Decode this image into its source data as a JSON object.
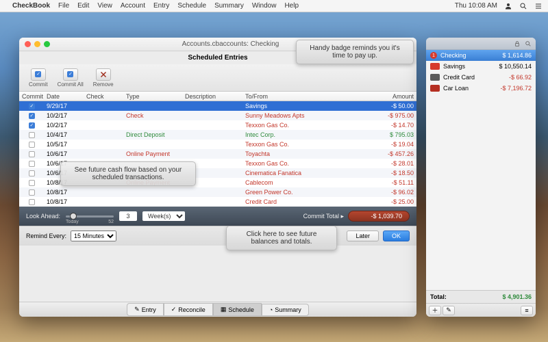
{
  "menubar": {
    "app": "CheckBook",
    "items": [
      "File",
      "Edit",
      "View",
      "Account",
      "Entry",
      "Schedule",
      "Summary",
      "Window",
      "Help"
    ],
    "clock": "Thu 10:08 AM"
  },
  "window": {
    "title": "Accounts.cbaccounts: Checking",
    "subtitle": "Scheduled Entries"
  },
  "toolbar": {
    "commit": "Commit",
    "commit_all": "Commit All",
    "remove": "Remove"
  },
  "columns": {
    "commit": "Commit",
    "date": "Date",
    "check": "Check",
    "type": "Type",
    "description": "Description",
    "tofrom": "To/From",
    "amount": "Amount"
  },
  "rows": [
    {
      "commit": true,
      "date": "9/29/17",
      "check": "",
      "type": "",
      "desc": "",
      "tofrom": "Savings",
      "amount": "-$ 50.00",
      "selected": true,
      "tocolor": "",
      "amtcolor": ""
    },
    {
      "commit": true,
      "date": "10/2/17",
      "check": "",
      "type": "Check",
      "desc": "",
      "tofrom": "Sunny Meadows Apts",
      "amount": "-$ 975.00",
      "selected": false,
      "tocolor": "red",
      "amtcolor": "red"
    },
    {
      "commit": true,
      "date": "10/2/17",
      "check": "",
      "type": "",
      "desc": "",
      "tofrom": "Texxon Gas Co.",
      "amount": "-$ 14.70",
      "selected": false,
      "tocolor": "red",
      "amtcolor": "red"
    },
    {
      "commit": false,
      "date": "10/4/17",
      "check": "",
      "type": "Direct Deposit",
      "desc": "",
      "tofrom": "Intec Corp.",
      "amount": "$ 795.03",
      "selected": false,
      "tocolor": "green",
      "amtcolor": "green"
    },
    {
      "commit": false,
      "date": "10/5/17",
      "check": "",
      "type": "",
      "desc": "",
      "tofrom": "Texxon Gas Co.",
      "amount": "-$ 19.04",
      "selected": false,
      "tocolor": "red",
      "amtcolor": "red"
    },
    {
      "commit": false,
      "date": "10/6/17",
      "check": "",
      "type": "Online Payment",
      "desc": "",
      "tofrom": "Toyachta",
      "amount": "-$ 457.26",
      "selected": false,
      "tocolor": "red",
      "amtcolor": "red"
    },
    {
      "commit": false,
      "date": "10/6/17",
      "check": "",
      "type": "",
      "desc": "",
      "tofrom": "Texxon Gas Co.",
      "amount": "-$ 28.01",
      "selected": false,
      "tocolor": "red",
      "amtcolor": "red"
    },
    {
      "commit": false,
      "date": "10/6/17",
      "check": "",
      "type": "",
      "desc": "",
      "tofrom": "Cinematica Fanatica",
      "amount": "-$ 18.50",
      "selected": false,
      "tocolor": "red",
      "amtcolor": "red"
    },
    {
      "commit": false,
      "date": "10/8/17",
      "check": "",
      "type": "Online Payment",
      "desc": "",
      "tofrom": "Cablecom",
      "amount": "-$ 51.11",
      "selected": false,
      "tocolor": "red",
      "amtcolor": "red"
    },
    {
      "commit": false,
      "date": "10/8/17",
      "check": "",
      "type": "",
      "desc": "",
      "tofrom": "Green Power Co.",
      "amount": "-$ 96.02",
      "selected": false,
      "tocolor": "red",
      "amtcolor": "red"
    },
    {
      "commit": false,
      "date": "10/8/17",
      "check": "",
      "type": "",
      "desc": "",
      "tofrom": "Credit Card",
      "amount": "-$ 25.00",
      "selected": false,
      "tocolor": "red",
      "amtcolor": "red"
    }
  ],
  "lookahead": {
    "label": "Look Ahead:",
    "today": "Today",
    "max": "52",
    "value": "3",
    "unit": "Week(s)",
    "commit_total_label": "Commit Total ▸",
    "commit_total": "-$ 1,039.70"
  },
  "remind": {
    "label": "Remind Every:",
    "value": "15 Minutes",
    "later": "Later",
    "ok": "OK"
  },
  "bottom_tabs": {
    "entry": "Entry",
    "reconcile": "Reconcile",
    "schedule": "Schedule",
    "summary": "Summary"
  },
  "accounts": {
    "header_icons": true,
    "list": [
      {
        "name": "Checking",
        "amount": "$ 1,614.86",
        "neg": false,
        "selected": true,
        "badge": "1"
      },
      {
        "name": "Savings",
        "amount": "$ 10,550.14",
        "neg": false,
        "selected": false,
        "color": "#d73a2d"
      },
      {
        "name": "Credit Card",
        "amount": "-$ 66.92",
        "neg": true,
        "selected": false,
        "color": "#5a5a5a"
      },
      {
        "name": "Car Loan",
        "amount": "-$ 7,196.72",
        "neg": true,
        "selected": false,
        "color": "#b52f22"
      }
    ],
    "total_label": "Total:",
    "total_amount": "$ 4,901.36"
  },
  "callouts": {
    "c1": "Handy badge reminds you it's time to pay up.",
    "c2": "See future cash flow based on your scheduled transactions.",
    "c3": "Click here to see future balances and totals."
  }
}
